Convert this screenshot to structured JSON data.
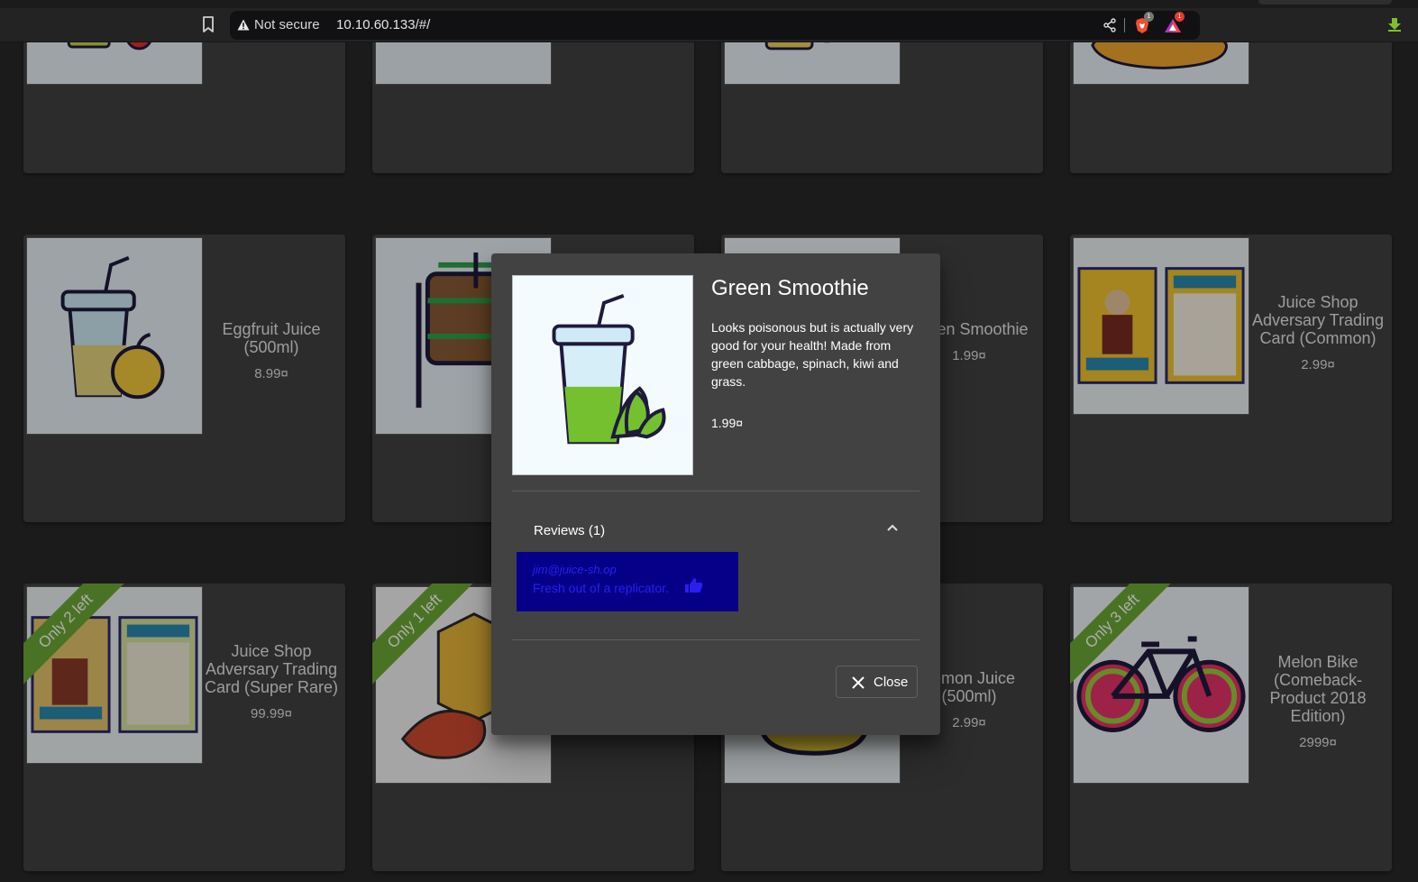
{
  "browser": {
    "security_label": "Not secure",
    "url": "10.10.60.133/#/",
    "badges": {
      "shields_count": "1",
      "rewards_count": "1"
    },
    "icons": [
      "bookmark-icon",
      "warning-icon",
      "share-icon",
      "brave-shields-icon",
      "brave-rewards-icon",
      "download-icon"
    ]
  },
  "products": [
    {
      "name": "",
      "price": ""
    },
    {
      "name": "",
      "price": ""
    },
    {
      "name": "",
      "price": ""
    },
    {
      "name": "",
      "price": ""
    },
    {
      "name": "Eggfruit Juice (500ml)",
      "price": "8.99¤"
    },
    {
      "name": "",
      "price": ""
    },
    {
      "name": "Green Smoothie",
      "price": "1.99¤"
    },
    {
      "name": "Juice Shop Adversary Trading Card (Common)",
      "price": "2.99¤"
    },
    {
      "name": "Juice Shop Adversary Trading Card (Super Rare)",
      "price": "99.99¤",
      "ribbon": "Only 2 left"
    },
    {
      "name": "",
      "price": "",
      "ribbon": "Only 1 left"
    },
    {
      "name": "Lemon Juice (500ml)",
      "price": "2.99¤"
    },
    {
      "name": "Melon Bike (Comeback-Product 2018 Edition)",
      "price": "2999¤",
      "ribbon": "Only 3 left"
    }
  ],
  "dialog": {
    "title": "Green Smoothie",
    "description": "Looks poisonous but is actually very good for your health! Made from green cabbage, spinach, kiwi and grass.",
    "price": "1.99¤",
    "reviews_header": "Reviews (1)",
    "reviews": [
      {
        "author": "jim@juice-sh.op",
        "text": "Fresh out of a replicator."
      }
    ],
    "close_label": "Close"
  },
  "colors": {
    "background": "#282828",
    "card": "#424242",
    "ribbon": "#6ea935",
    "review_bg": "#060088",
    "review_text": "#2a1ef0"
  }
}
